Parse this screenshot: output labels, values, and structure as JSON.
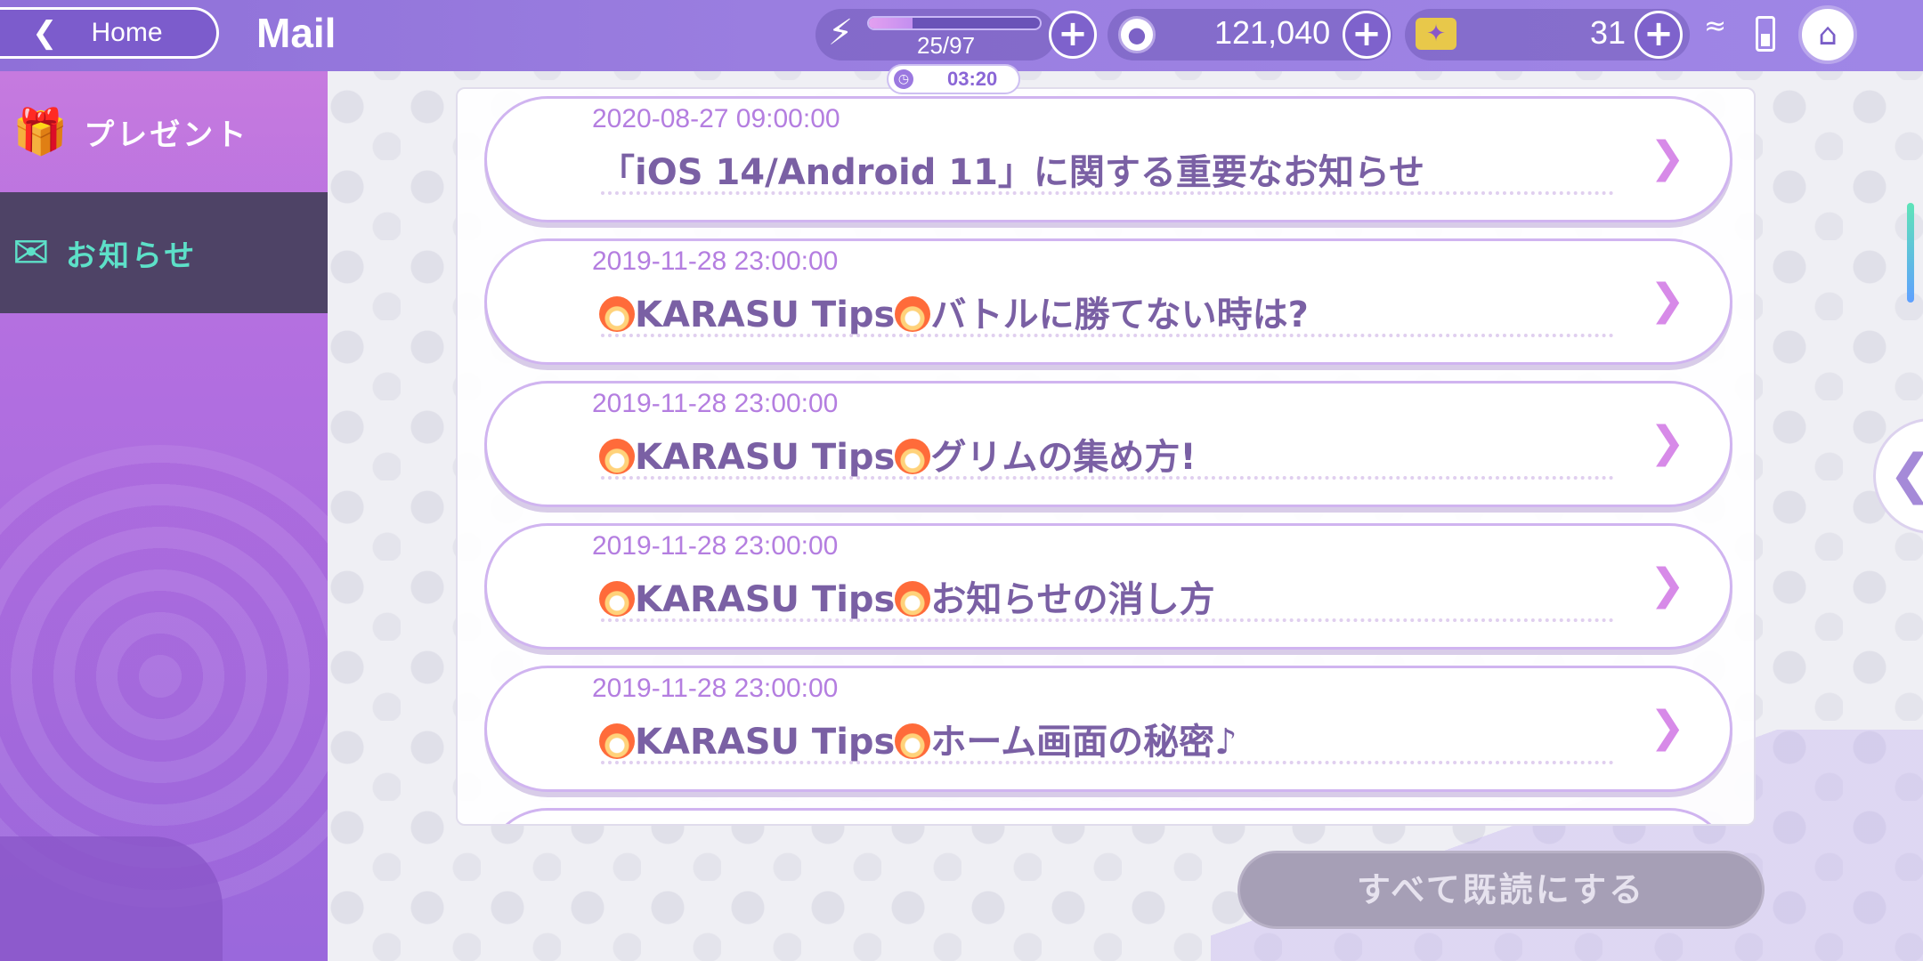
{
  "header": {
    "back_label": "Home",
    "title": "Mail",
    "stamina_text": "25/97",
    "stamina_fraction": 0.2577,
    "timer": "03:20",
    "coins": "121,040",
    "gems": "31"
  },
  "sidebar": {
    "items": [
      {
        "label": "プレゼント",
        "icon": "gift-icon",
        "active": false
      },
      {
        "label": "お知らせ",
        "icon": "mail-star-icon",
        "active": true
      }
    ]
  },
  "mails": [
    {
      "date": "2020-08-27 09:00:00",
      "title": "「iOS 14/Android 11」に関する重要なお知らせ",
      "fire": false
    },
    {
      "date": "2019-11-28 23:00:00",
      "prefix": "KARASU Tips",
      "title": "バトルに勝てない時は?",
      "fire": true
    },
    {
      "date": "2019-11-28 23:00:00",
      "prefix": "KARASU Tips",
      "title": "グリムの集め方!",
      "fire": true
    },
    {
      "date": "2019-11-28 23:00:00",
      "prefix": "KARASU Tips",
      "title": "お知らせの消し方",
      "fire": true
    },
    {
      "date": "2019-11-28 23:00:00",
      "prefix": "KARASU Tips",
      "title": "ホーム画面の秘密♪",
      "fire": true
    }
  ],
  "footer": {
    "mark_all_read": "すべて既読にする"
  },
  "colors": {
    "accent": "#8f70d8",
    "sidebar_active": "#4e4366",
    "active_text": "#5de0c8",
    "date_text": "#b47ee0",
    "title_text": "#7a60a4"
  }
}
